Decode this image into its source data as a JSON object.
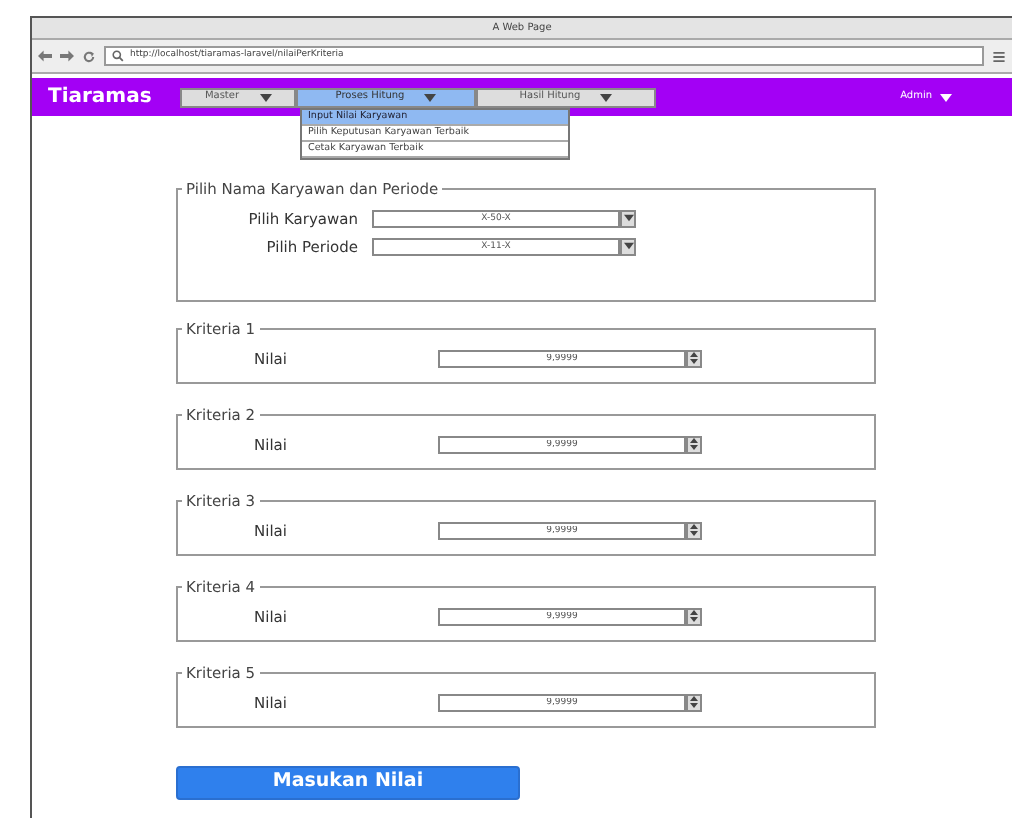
{
  "window": {
    "title": "A Web Page"
  },
  "browser": {
    "url": "http://localhost/tiaramas-laravel/nilaiPerKriteria"
  },
  "navbar": {
    "brand": "Tiaramas",
    "menus": [
      {
        "label": "Master",
        "selected": false
      },
      {
        "label": "Proses Hitung",
        "selected": true
      },
      {
        "label": "Hasil Hitung",
        "selected": false
      }
    ],
    "user": "Admin"
  },
  "dropdown": [
    {
      "label": "Input Nilai Karyawan",
      "selected": true
    },
    {
      "label": "Pilih Keputusan Karyawan Terbaik",
      "selected": false
    },
    {
      "label": "Cetak Karyawan Terbaik",
      "selected": false
    }
  ],
  "selection": {
    "legend": "Pilih Nama Karyawan dan Periode",
    "fields": [
      {
        "label": "Pilih Karyawan",
        "value": "X-50-X"
      },
      {
        "label": "Pilih Periode",
        "value": "X-11-X"
      }
    ]
  },
  "criteria": [
    {
      "legend": "Kriteria 1",
      "label": "Nilai",
      "value": "9,9999"
    },
    {
      "legend": "Kriteria 2",
      "label": "Nilai",
      "value": "9,9999"
    },
    {
      "legend": "Kriteria 3",
      "label": "Nilai",
      "value": "9,9999"
    },
    {
      "legend": "Kriteria 4",
      "label": "Nilai",
      "value": "9,9999"
    },
    {
      "legend": "Kriteria 5",
      "label": "Nilai",
      "value": "9,9999"
    }
  ],
  "submit": "Masukan Nilai"
}
